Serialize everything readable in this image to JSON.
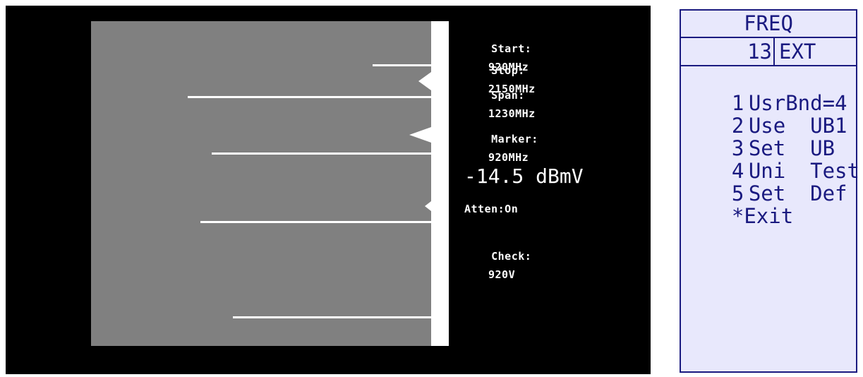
{
  "analyzer": {
    "start_label": "Start:",
    "start_value": "920MHz",
    "stop_label": "Stop:",
    "stop_value": "2150MHz",
    "span_label": "Span:",
    "span_value": "1230MHz",
    "marker_label": "Marker:",
    "marker_value": "920MHz",
    "level": "-14.5 dBmV",
    "atten": "Atten:On",
    "check_label": "Check:",
    "check_value": "920V"
  },
  "menu": {
    "title": "FREQ",
    "channel": "13",
    "mode": "EXT",
    "items": [
      {
        "num": "1",
        "label": "UsrBnd=4"
      },
      {
        "num": "2",
        "label": "Use  UB1"
      },
      {
        "num": "3",
        "label": "Set  UB"
      },
      {
        "num": "4",
        "label": "Uni  Test"
      },
      {
        "num": "5",
        "label": "Set  Def"
      },
      {
        "num": "*",
        "label": "Exit"
      }
    ]
  },
  "colors": {
    "screen_bg": "#000000",
    "plot_bg": "#808080",
    "trace": "#ffffff",
    "lcd_bg": "#e8e8fc",
    "lcd_ink": "#1a1a80"
  }
}
